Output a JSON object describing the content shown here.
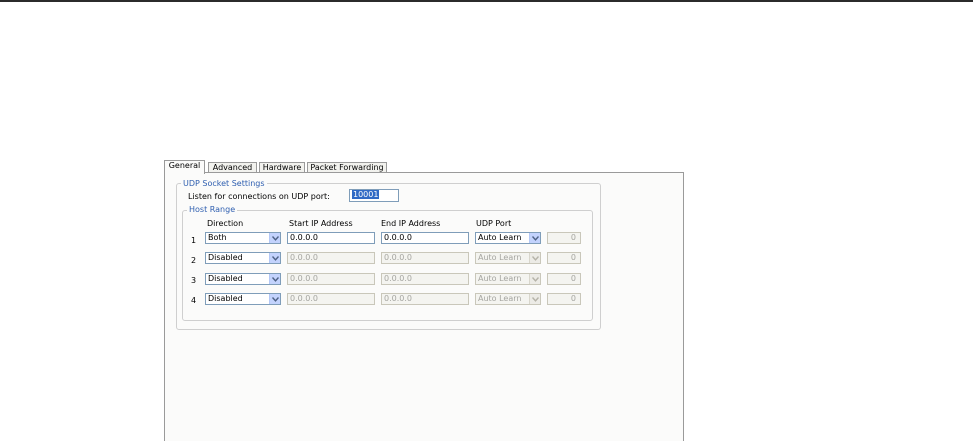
{
  "tabs": [
    "General",
    "Advanced",
    "Hardware",
    "Packet Forwarding"
  ],
  "udp_socket": {
    "title": "UDP Socket Settings",
    "listen_label": "Listen for connections on UDP port:",
    "listen_port": "10001"
  },
  "host_range": {
    "title": "Host Range",
    "headers": {
      "direction": "Direction",
      "start_ip": "Start IP Address",
      "end_ip": "End IP Address",
      "udp_port": "UDP Port"
    },
    "rows": [
      {
        "num": "1",
        "direction": "Both",
        "start_ip": "0.0.0.0",
        "end_ip": "0.0.0.0",
        "port_mode": "Auto Learn",
        "port_value": "0",
        "enabled": true
      },
      {
        "num": "2",
        "direction": "Disabled",
        "start_ip": "0.0.0.0",
        "end_ip": "0.0.0.0",
        "port_mode": "Auto Learn",
        "port_value": "0",
        "enabled": false
      },
      {
        "num": "3",
        "direction": "Disabled",
        "start_ip": "0.0.0.0",
        "end_ip": "0.0.0.0",
        "port_mode": "Auto Learn",
        "port_value": "0",
        "enabled": false
      },
      {
        "num": "4",
        "direction": "Disabled",
        "start_ip": "0.0.0.0",
        "end_ip": "0.0.0.0",
        "port_mode": "Auto Learn",
        "port_value": "0",
        "enabled": false
      }
    ]
  },
  "icons": {
    "dropdown": "chevron-down-icon"
  }
}
